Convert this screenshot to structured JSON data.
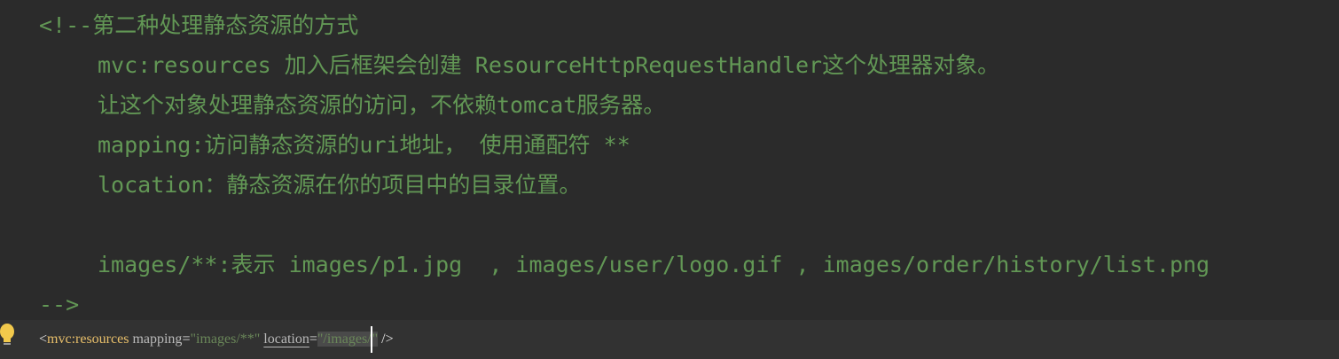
{
  "comment": {
    "open": "<!--第二种处理静态资源的方式",
    "lines": [
      "mvc:resources 加入后框架会创建 ResourceHttpRequestHandler这个处理器对象。",
      "让这个对象处理静态资源的访问，不依赖tomcat服务器。",
      "mapping:访问静态资源的uri地址， 使用通配符 **",
      "location：静态资源在你的项目中的目录位置。",
      "",
      "images/**:表示 images/p1.jpg  , images/user/logo.gif , images/order/history/list.png"
    ],
    "close": "-->"
  },
  "code": {
    "tag_open": "<",
    "tag_name": "mvc:resources",
    "attr1_name": "mapping",
    "attr1_eq": "=",
    "attr1_value": "\"images/**\"",
    "attr2_name": "location",
    "attr2_eq": "=",
    "attr2_value_selected": "\"/images/",
    "attr2_value_rest": "\"",
    "tag_close": " />"
  },
  "colors": {
    "background": "#2b2b2b",
    "comment": "#629755",
    "tag": "#e8bf6a",
    "attribute": "#bababa",
    "value": "#6a8759",
    "current_line": "#323232"
  },
  "icons": {
    "gutter": "lightbulb-icon"
  }
}
